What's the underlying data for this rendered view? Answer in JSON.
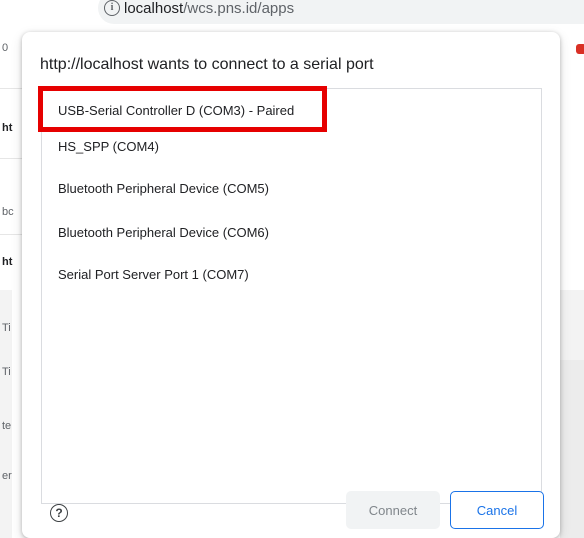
{
  "browser": {
    "url_host": "localhost",
    "url_path": "/wcs.pns.id/apps"
  },
  "background": {
    "fragments": [
      "0",
      "ht",
      "bc",
      "ht",
      "Ti",
      "Ti",
      "te",
      "er"
    ]
  },
  "dialog": {
    "title": "http://localhost wants to connect to a serial port",
    "ports": [
      {
        "label": "USB-Serial Controller D (COM3) - Paired"
      },
      {
        "label": "HS_SPP (COM4)"
      },
      {
        "label": "Bluetooth Peripheral Device (COM5)"
      },
      {
        "label": "Bluetooth Peripheral Device (COM6)"
      },
      {
        "label": "Serial Port Server Port 1 (COM7)"
      }
    ],
    "help_glyph": "?",
    "connect_label": "Connect",
    "cancel_label": "Cancel"
  },
  "colors": {
    "highlight": "#e60000",
    "accent": "#1a73e8"
  }
}
